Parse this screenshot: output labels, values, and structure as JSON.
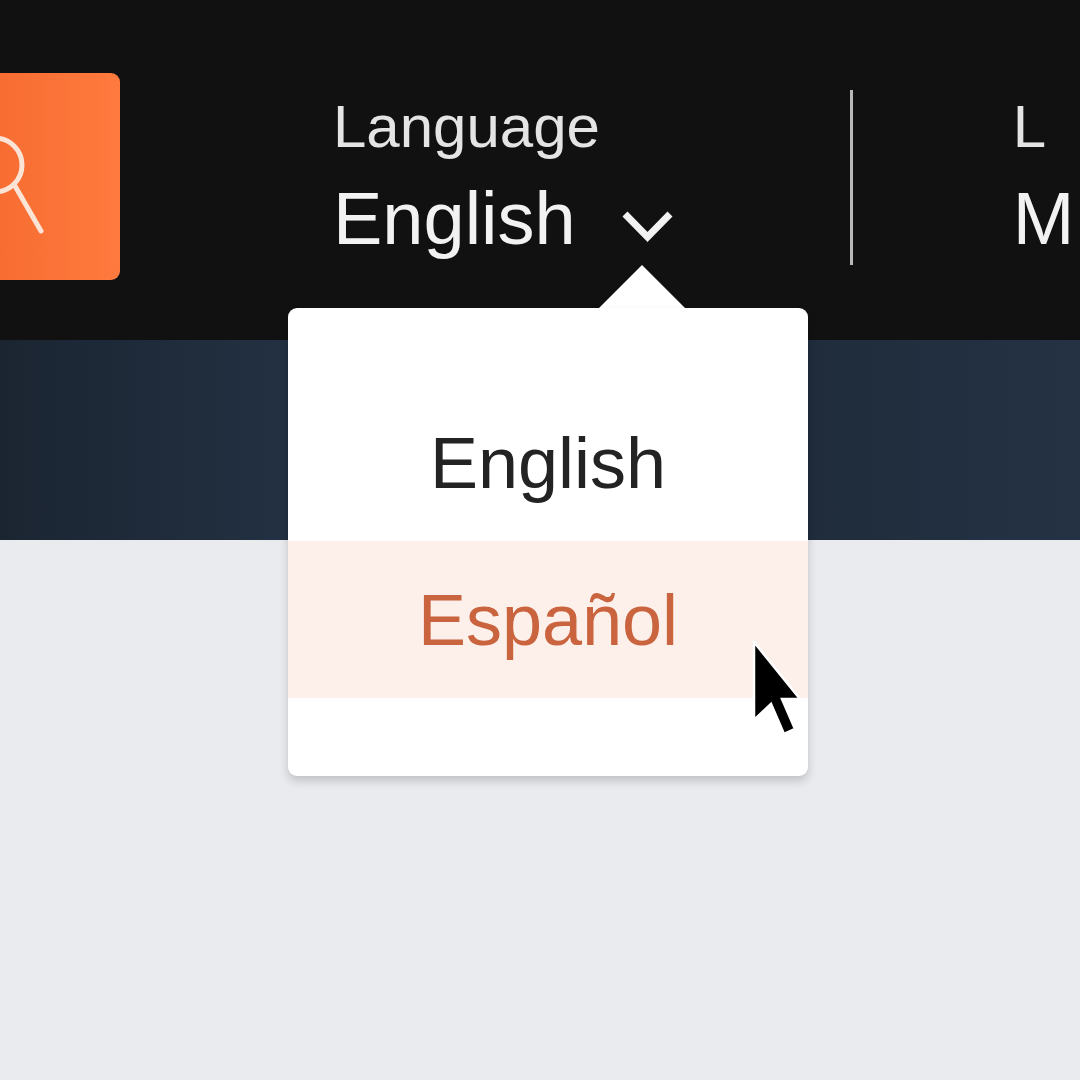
{
  "header": {
    "language_selector": {
      "label": "Language",
      "value": "English",
      "expanded": true
    },
    "item_2": {
      "label": "L",
      "value": "M"
    }
  },
  "language_menu": {
    "options": [
      {
        "label": "English",
        "selected": false
      },
      {
        "label": "Español",
        "selected": true
      }
    ]
  }
}
